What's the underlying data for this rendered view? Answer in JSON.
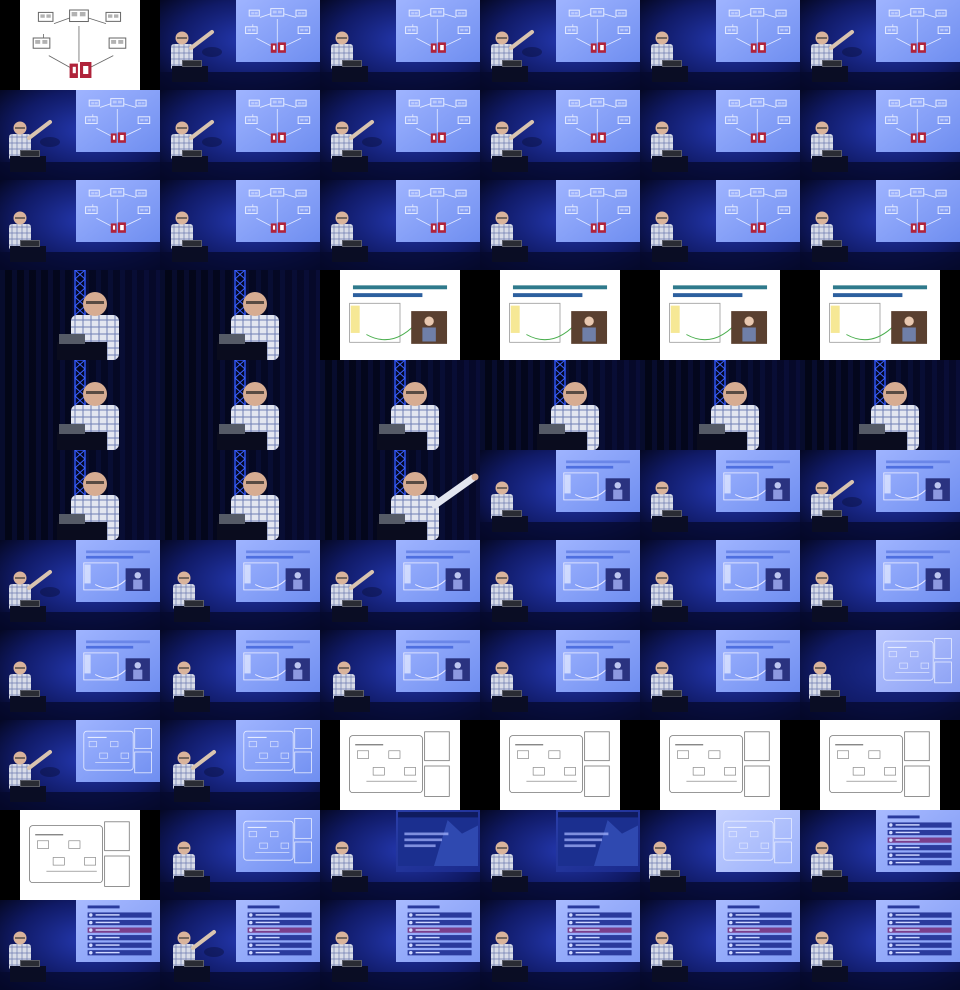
{
  "sheet": {
    "columns": 6,
    "rows": 11,
    "frames": [
      "slide-network",
      "stage-network-left-gesture",
      "stage-network-left",
      "stage-network-left-gesture",
      "stage-network-left",
      "stage-network-left-gesture",
      "stage-network-right-gesture",
      "stage-network-left-gesture",
      "stage-network-left-gesture",
      "stage-network-left-gesture",
      "stage-network-left",
      "stage-network-left",
      "stage-network-right",
      "stage-network-left",
      "stage-network-left",
      "stage-network-left",
      "stage-network-left",
      "stage-network-left",
      "closeup-truss",
      "closeup-truss",
      "slide-architecture",
      "slide-architecture",
      "slide-architecture",
      "slide-architecture",
      "closeup-truss",
      "closeup-truss",
      "closeup-truss",
      "closeup-truss",
      "closeup-truss",
      "closeup-truss",
      "closeup-truss",
      "closeup-truss",
      "closeup-gesture",
      "stage-architecture",
      "stage-architecture",
      "stage-architecture-gesture",
      "stage-architecture-right-gesture",
      "stage-architecture-left",
      "stage-architecture-gesture",
      "stage-architecture",
      "stage-architecture",
      "stage-architecture",
      "stage-architecture-right",
      "stage-architecture-left",
      "stage-architecture-left",
      "stage-architecture",
      "stage-architecture",
      "stage-model-dim",
      "stage-model-right-gesture",
      "stage-model-left-gesture",
      "slide-model",
      "slide-model",
      "slide-model",
      "slide-model",
      "slide-model",
      "stage-model-left",
      "stage-dark-slide",
      "stage-dark-slide",
      "stage-model-light",
      "stage-list",
      "stage-list-right",
      "stage-list-left-gesture",
      "stage-list",
      "stage-list",
      "stage-list",
      "stage-list"
    ]
  },
  "colors": {
    "background": "#000000",
    "stage_blue": "#1a2a8c",
    "screen_light": "#8fa8ff",
    "slide_white": "#ffffff",
    "bar_purple": "#4a3fa0",
    "truss_blue": "#2a4ee0"
  }
}
